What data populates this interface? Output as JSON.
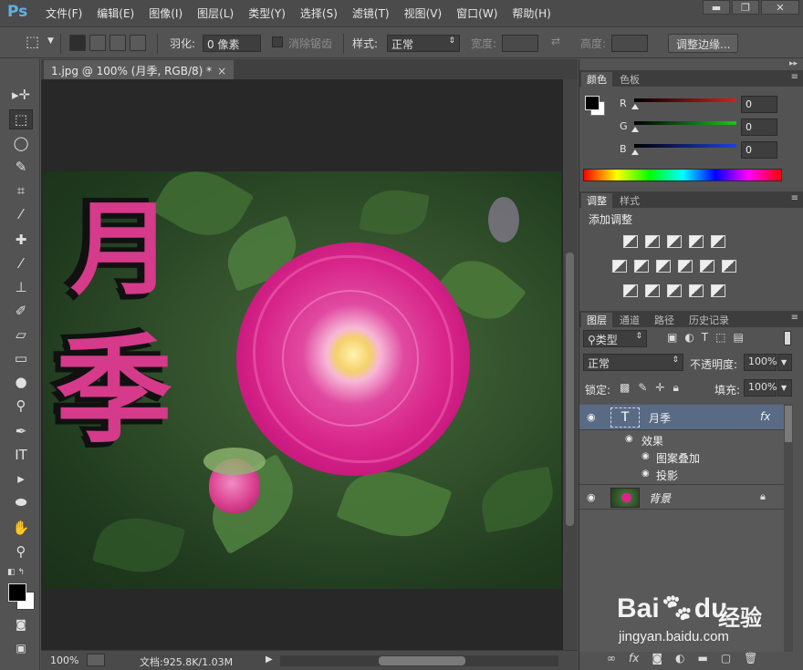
{
  "app": {
    "logo": "Ps"
  },
  "menu": [
    "文件(F)",
    "编辑(E)",
    "图像(I)",
    "图层(L)",
    "类型(Y)",
    "选择(S)",
    "滤镜(T)",
    "视图(V)",
    "窗口(W)",
    "帮助(H)"
  ],
  "window_controls": {
    "minimize": "▬",
    "restore": "❐",
    "close": "✕"
  },
  "options": {
    "feather_label": "羽化:",
    "feather_value": "0 像素",
    "antialias_label": "消除锯齿",
    "style_label": "样式:",
    "style_value": "正常",
    "width_label": "宽度:",
    "height_label": "高度:",
    "refine_edge_button": "调整边缘..."
  },
  "document": {
    "tab_title": "1.jpg @ 100% (月季, RGB/8) *",
    "tab_close": "×",
    "canvas_text_1": "月",
    "canvas_text_2": "季"
  },
  "status": {
    "zoom": "100%",
    "doc_info": "文档:925.8K/1.03M"
  },
  "color_panel": {
    "tabs": [
      "颜色",
      "色板"
    ],
    "channels": [
      {
        "name": "R",
        "value": "0",
        "color": "#d42020"
      },
      {
        "name": "G",
        "value": "0",
        "color": "#20c020"
      },
      {
        "name": "B",
        "value": "0",
        "color": "#2040e0"
      }
    ],
    "foreground": "#000000",
    "background": "#ffffff"
  },
  "adjustments_panel": {
    "tabs": [
      "调整",
      "样式"
    ],
    "heading": "添加调整"
  },
  "layers_panel": {
    "tabs": [
      "图层",
      "通道",
      "路径",
      "历史记录"
    ],
    "filter_value": "类型",
    "blend_mode": "正常",
    "opacity_label": "不透明度:",
    "opacity_value": "100%",
    "lock_label": "锁定:",
    "fill_label": "填充:",
    "fill_value": "100%",
    "layers": [
      {
        "name": "月季",
        "type": "text",
        "thumb_glyph": "T",
        "fx": "fx",
        "selected": true
      },
      {
        "name": "背景",
        "type": "image",
        "selected": false,
        "locked": true
      }
    ],
    "effects_label": "效果",
    "effects": [
      "图案叠加",
      "投影"
    ],
    "bottom_icons": [
      "link-icon",
      "fx-icon",
      "mask-icon",
      "adjustment-icon",
      "folder-icon",
      "new-layer-icon",
      "trash-icon"
    ]
  },
  "watermark": {
    "logo": "Bai",
    "logo_tail": "du",
    "cn": "经验",
    "url": "jingyan.baidu.com"
  }
}
